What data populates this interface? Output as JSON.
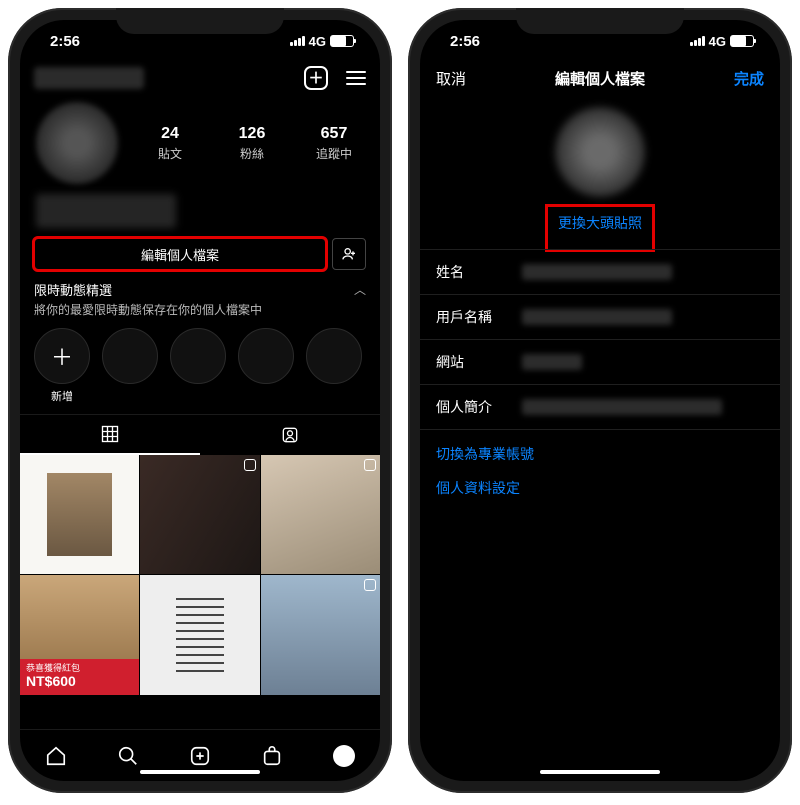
{
  "status": {
    "time": "2:56",
    "net": "4G"
  },
  "left": {
    "stats": [
      {
        "num": "24",
        "label": "貼文"
      },
      {
        "num": "126",
        "label": "粉絲"
      },
      {
        "num": "657",
        "label": "追蹤中"
      }
    ],
    "edit_profile": "編輯個人檔案",
    "highlights_title": "限時動態精選",
    "highlights_sub": "將你的最愛限時動態保存在你的個人檔案中",
    "new_label": "新增",
    "price_caption": "恭喜獲得紅包",
    "price": "NT$600"
  },
  "right": {
    "cancel": "取消",
    "title": "編輯個人檔案",
    "done": "完成",
    "change_photo": "更換大頭貼照",
    "fields": {
      "name": "姓名",
      "username": "用戶名稱",
      "website": "網站",
      "bio": "個人簡介"
    },
    "switch_pro": "切換為專業帳號",
    "data_settings": "個人資料設定"
  }
}
